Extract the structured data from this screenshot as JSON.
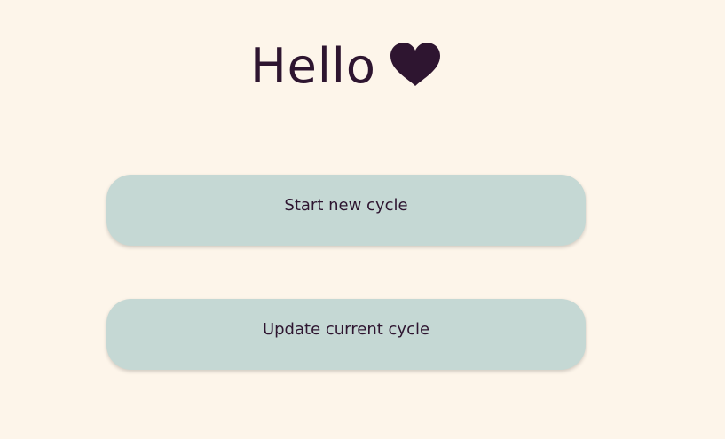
{
  "greeting": {
    "text": "Hello",
    "icon": "heart-icon",
    "color": "#2e1530"
  },
  "actions": {
    "start_label": "Start new cycle",
    "update_label": "Update current cycle",
    "button_color": "#c5d8d4"
  },
  "theme": {
    "background": "#fdf5ea",
    "text_color": "#2e1530"
  }
}
